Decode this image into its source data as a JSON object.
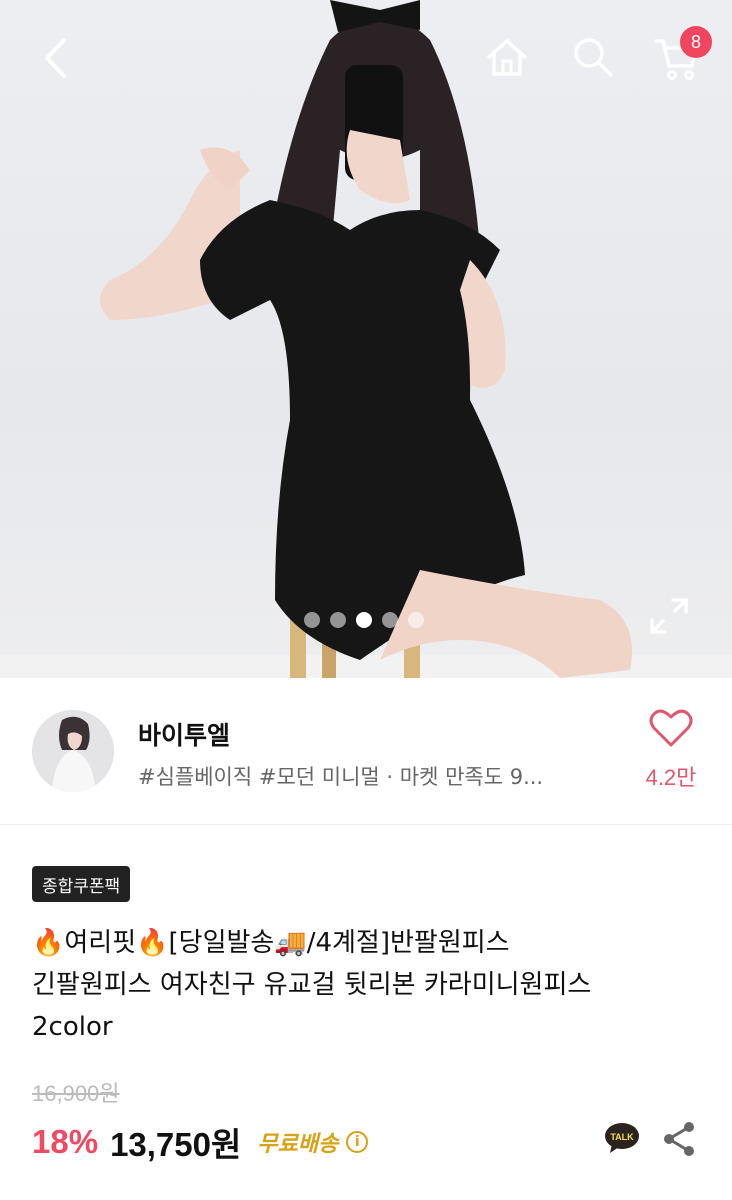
{
  "header": {
    "back": "back-icon",
    "home": "home-icon",
    "search": "search-icon",
    "cart": "cart-icon",
    "cart_count": "8"
  },
  "gallery": {
    "image_count": 5,
    "active_index": 2,
    "expand": "expand-icon"
  },
  "seller": {
    "name": "바이투엘",
    "tags": "#심플베이직 #모던 미니멀 · 마켓 만족도 9...",
    "like_count": "4.2만"
  },
  "product": {
    "coupon_label": "종합쿠폰팩",
    "title_line1": "🔥여리핏🔥[당일발송🚚/4계절]반팔원피스",
    "title_line2": "긴팔원피스 여자친구 유교걸 뒷리본 카라미니원피스",
    "title_line3": "2color",
    "original_price": "16,900원",
    "discount": "18%",
    "price": "13,750원",
    "shipping": "무료배송",
    "info_icon": "i"
  },
  "colors": {
    "accent": "#ef4a63",
    "shipping": "#d9a216",
    "badge": "#f0455f"
  }
}
